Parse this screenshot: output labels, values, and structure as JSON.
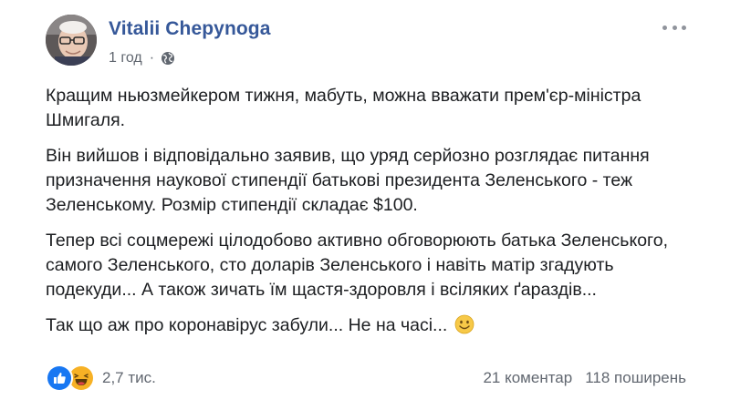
{
  "post": {
    "author_name": "Vitalii Chepynoga",
    "timestamp": "1 год",
    "separator": "·",
    "privacy_icon": "globe-icon",
    "more_icon": "more-options-icon",
    "paragraphs": [
      "Кращим ньюзмейкером тижня, мабуть, можна вважати прем'єр-міністра Шмигаля.",
      "Він вийшов і відповідально заявив, що уряд серйозно розглядає питання призначення наукової стипендії батькові президента Зеленського - теж Зеленському. Розмір стипендії складає $100.",
      "Тепер всі соцмережі цілодобово активно обговорюють батька Зеленського, самого Зеленського, сто доларів Зеленського і навіть матір згадують подекуди... А також зичать їм щастя-здоровля і всіляких ґараздів...",
      "Так що аж про коронавірус забули... Не на часі..."
    ],
    "closing_emoji": "smile-emoji"
  },
  "footer": {
    "reaction_icons": [
      "like-reaction-icon",
      "haha-reaction-icon"
    ],
    "reaction_count": "2,7 тис.",
    "comments": "21 коментар",
    "shares": "118 поширень"
  },
  "colors": {
    "author_link": "#365899",
    "meta_text": "#616770",
    "body_text": "#1c1e21",
    "like_blue": "#1877f2",
    "haha_yellow": "#f7b125"
  }
}
